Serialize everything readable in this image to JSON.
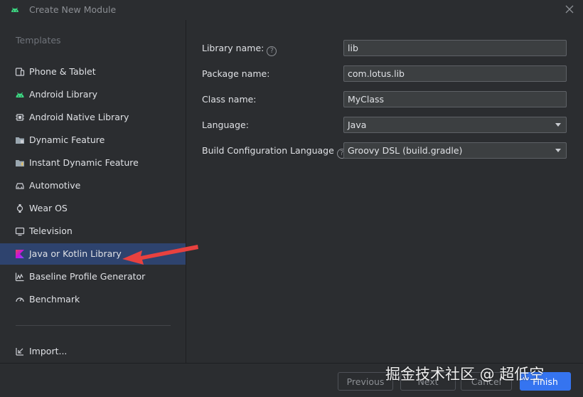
{
  "window": {
    "title": "Create New Module"
  },
  "sidebar": {
    "section_label": "Templates",
    "items": [
      {
        "label": "Phone & Tablet",
        "icon": "phone-tablet-icon"
      },
      {
        "label": "Android Library",
        "icon": "android-icon"
      },
      {
        "label": "Android Native Library",
        "icon": "native-library-icon"
      },
      {
        "label": "Dynamic Feature",
        "icon": "dynamic-feature-icon"
      },
      {
        "label": "Instant Dynamic Feature",
        "icon": "instant-feature-icon"
      },
      {
        "label": "Automotive",
        "icon": "car-icon"
      },
      {
        "label": "Wear OS",
        "icon": "watch-icon"
      },
      {
        "label": "Television",
        "icon": "tv-icon"
      },
      {
        "label": "Java or Kotlin Library",
        "icon": "kotlin-icon",
        "selected": true
      },
      {
        "label": "Baseline Profile Generator",
        "icon": "chart-icon"
      },
      {
        "label": "Benchmark",
        "icon": "gauge-icon"
      }
    ],
    "import_label": "Import..."
  },
  "form": {
    "library_name": {
      "label": "Library name:",
      "value": "lib"
    },
    "package_name": {
      "label": "Package name:",
      "value": "com.lotus.lib"
    },
    "class_name": {
      "label": "Class name:",
      "value": "MyClass"
    },
    "language": {
      "label": "Language:",
      "value": "Java"
    },
    "build_config": {
      "label": "Build Configuration Language",
      "value": "Groovy DSL (build.gradle)"
    }
  },
  "footer": {
    "previous_label": "Previous",
    "next_label": "Next",
    "cancel_label": "Cancel",
    "finish_label": "Finish"
  },
  "watermark": "掘金技术社区 @ 超低空",
  "colors": {
    "accent": "#3574f0",
    "selection": "#2e436e",
    "annotation_arrow": "#e8413f",
    "android_green": "#3ddc84"
  }
}
